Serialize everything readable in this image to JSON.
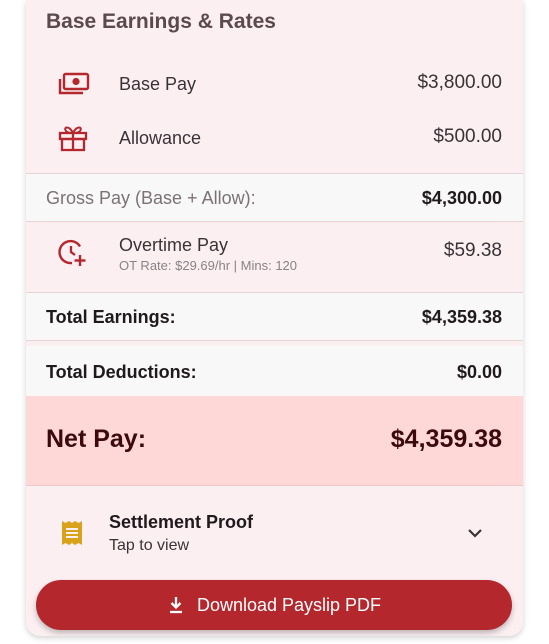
{
  "section_title": "Base Earnings & Rates",
  "base_pay": {
    "label": "Base Pay",
    "value": "$3,800.00",
    "icon": "cash-icon"
  },
  "allowance": {
    "label": "Allowance",
    "value": "$500.00",
    "icon": "gift-icon"
  },
  "gross_pay": {
    "label": "Gross Pay (Base + Allow):",
    "value": "$4,300.00"
  },
  "overtime": {
    "label": "Overtime Pay",
    "sublabel": "OT Rate: $29.69/hr | Mins: 120",
    "value": "$59.38",
    "icon": "clock-plus-icon"
  },
  "total_earnings": {
    "label": "Total Earnings:",
    "value": "$4,359.38"
  },
  "total_deductions": {
    "label": "Total Deductions:",
    "value": "$0.00"
  },
  "net_pay": {
    "label": "Net Pay:",
    "value": "$4,359.38"
  },
  "settlement": {
    "title": "Settlement Proof",
    "subtitle": "Tap to view",
    "icon": "receipt-icon"
  },
  "download_button": {
    "label": "Download Payslip PDF",
    "icon": "download-icon"
  },
  "colors": {
    "accent": "#b3272d",
    "card_bg": "#fbeff2",
    "net_bg": "#fdd8d6",
    "receipt": "#d9a21b"
  }
}
